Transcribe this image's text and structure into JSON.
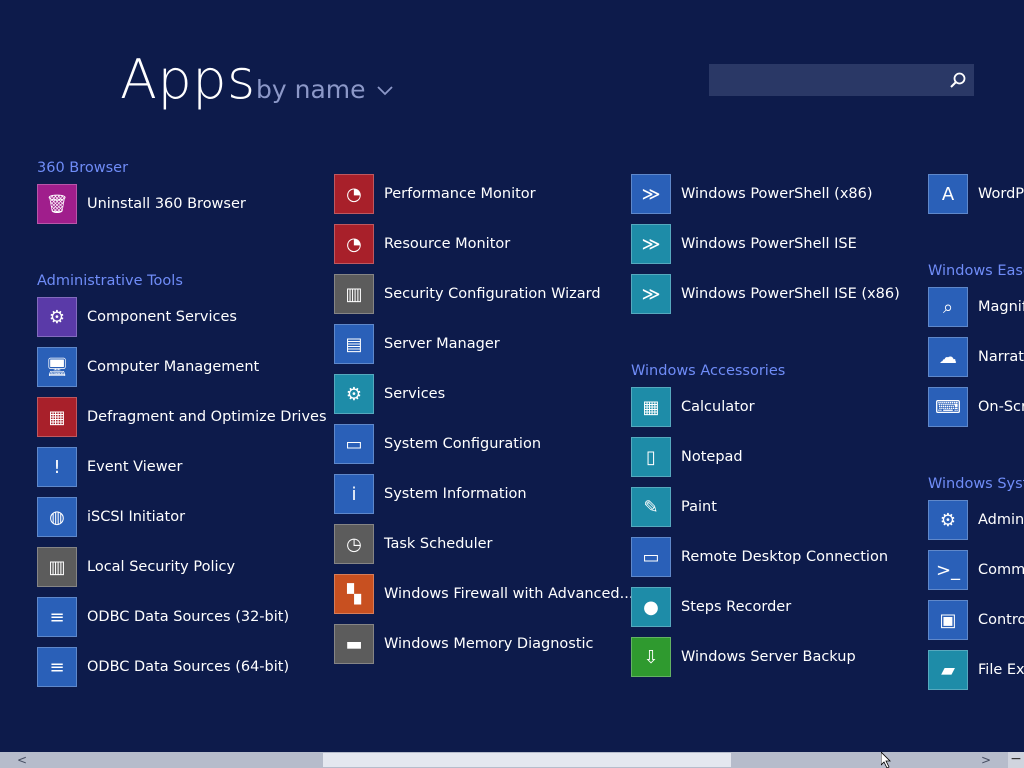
{
  "header": {
    "title": "Apps",
    "sort_label": "by name",
    "search_placeholder": ""
  },
  "columns": [
    {
      "groups": [
        {
          "heading": "360 Browser",
          "items": [
            {
              "label": "Uninstall 360 Browser",
              "icon": "trash-bin-icon",
              "color": "#a01e8c"
            }
          ]
        },
        {
          "heading": "Administrative Tools",
          "items": [
            {
              "label": "Component Services",
              "icon": "gear-globe-icon",
              "color": "#5a3aa8"
            },
            {
              "label": "Computer Management",
              "icon": "computer-icon",
              "color": "#2a60b8"
            },
            {
              "label": "Defragment and Optimize Drives",
              "icon": "defrag-icon",
              "color": "#a8202a"
            },
            {
              "label": "Event Viewer",
              "icon": "event-log-icon",
              "color": "#2a60b8"
            },
            {
              "label": "iSCSI Initiator",
              "icon": "globe-icon",
              "color": "#2a60b8"
            },
            {
              "label": "Local Security Policy",
              "icon": "server-lock-icon",
              "color": "#5c5c5c"
            },
            {
              "label": "ODBC Data Sources (32-bit)",
              "icon": "database-icon",
              "color": "#2a60b8"
            },
            {
              "label": "ODBC Data Sources (64-bit)",
              "icon": "database-icon",
              "color": "#2a60b8"
            }
          ]
        }
      ]
    },
    {
      "groups": [
        {
          "heading": "",
          "items": [
            {
              "label": "Performance Monitor",
              "icon": "gauge-icon",
              "color": "#a8202a"
            },
            {
              "label": "Resource Monitor",
              "icon": "gauge-icon",
              "color": "#a8202a"
            },
            {
              "label": "Security Configuration Wizard",
              "icon": "server-lock-icon",
              "color": "#5c5c5c"
            },
            {
              "label": "Server Manager",
              "icon": "server-manager-icon",
              "color": "#2a60b8"
            },
            {
              "label": "Services",
              "icon": "gears-icon",
              "color": "#1e8ca8"
            },
            {
              "label": "System Configuration",
              "icon": "monitor-icon",
              "color": "#2a60b8"
            },
            {
              "label": "System Information",
              "icon": "info-monitor-icon",
              "color": "#2a60b8"
            },
            {
              "label": "Task Scheduler",
              "icon": "clock-icon",
              "color": "#5c5c5c"
            },
            {
              "label": "Windows Firewall with Advanced...",
              "icon": "firewall-icon",
              "color": "#c85020"
            },
            {
              "label": "Windows Memory Diagnostic",
              "icon": "memory-chip-icon",
              "color": "#5c5c5c"
            }
          ]
        }
      ]
    },
    {
      "groups": [
        {
          "heading": "",
          "items": [
            {
              "label": "Windows PowerShell (x86)",
              "icon": "powershell-icon",
              "color": "#2a60b8"
            },
            {
              "label": "Windows PowerShell ISE",
              "icon": "powershell-ise-icon",
              "color": "#1e8ca8"
            },
            {
              "label": "Windows PowerShell ISE (x86)",
              "icon": "powershell-ise-icon",
              "color": "#1e8ca8"
            }
          ]
        },
        {
          "heading": "Windows Accessories",
          "items": [
            {
              "label": "Calculator",
              "icon": "calculator-icon",
              "color": "#1e8ca8"
            },
            {
              "label": "Notepad",
              "icon": "notepad-icon",
              "color": "#1e8ca8"
            },
            {
              "label": "Paint",
              "icon": "palette-icon",
              "color": "#1e8ca8"
            },
            {
              "label": "Remote Desktop Connection",
              "icon": "remote-desktop-icon",
              "color": "#2a60b8"
            },
            {
              "label": "Steps Recorder",
              "icon": "record-icon",
              "color": "#1e8ca8"
            },
            {
              "label": "Windows Server Backup",
              "icon": "backup-icon",
              "color": "#2f9a2f"
            }
          ]
        }
      ]
    },
    {
      "groups": [
        {
          "heading": "",
          "items": [
            {
              "label": "WordPa",
              "icon": "wordpad-icon",
              "color": "#2a60b8"
            }
          ]
        },
        {
          "heading": "Windows Ease",
          "items": [
            {
              "label": "Magnifi",
              "icon": "magnifier-icon",
              "color": "#2a60b8"
            },
            {
              "label": "Narrato",
              "icon": "narrator-icon",
              "color": "#2a60b8"
            },
            {
              "label": "On-Scre",
              "icon": "keyboard-icon",
              "color": "#2a60b8"
            }
          ]
        },
        {
          "heading": "Windows Syste",
          "items": [
            {
              "label": "Admini",
              "icon": "admin-tools-icon",
              "color": "#2a60b8"
            },
            {
              "label": "Comma",
              "icon": "command-prompt-icon",
              "color": "#2a60b8"
            },
            {
              "label": "Contro",
              "icon": "control-panel-icon",
              "color": "#2a60b8"
            },
            {
              "label": "File Exp",
              "icon": "folder-icon",
              "color": "#1e8ca8"
            }
          ]
        }
      ]
    }
  ],
  "scrollbar": {
    "left_arrow": "<",
    "right_arrow": ">",
    "minus": "−"
  }
}
